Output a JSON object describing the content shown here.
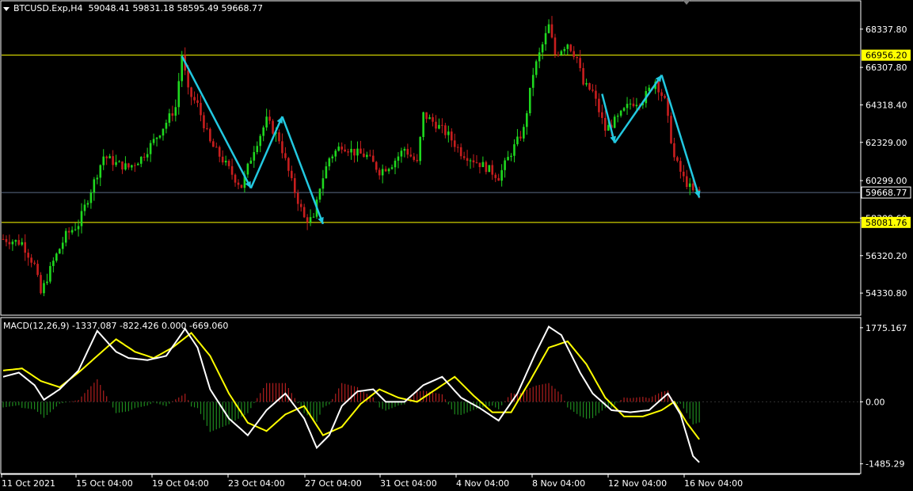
{
  "header": {
    "symbol": "BTCUSD.Exp,H4",
    "open": "59048.41",
    "high": "59831.18",
    "low": "58595.49",
    "close": "59668.77"
  },
  "macd": {
    "label": "MACD(12,26,9)",
    "values": "-1337.087 -822.426 0.000 -669.060",
    "top_label": "1775.167",
    "zero_label": "0.00",
    "bottom_label": "-1485.29",
    "top_value": 1775.167,
    "bottom_value": -1485.29
  },
  "price_axis": {
    "labels": [
      "68337.80",
      "66307.80",
      "64318.40",
      "62329.00",
      "60299.00",
      "58309.60",
      "56320.20",
      "54330.80"
    ],
    "max": 69800,
    "min": 53200
  },
  "levels": [
    {
      "value": 66956.2,
      "label": "66956.20",
      "color": "#ffff00",
      "label_bg": "#ffff00",
      "label_fg": "#000000"
    },
    {
      "value": 58081.76,
      "label": "58081.76",
      "color": "#ffff00",
      "label_bg": "#ffff00",
      "label_fg": "#000000"
    }
  ],
  "current_price": {
    "value": 59668.77,
    "label": "59668.77",
    "color": "#5a6a86"
  },
  "time_axis": [
    "11 Oct 2021",
    "15 Oct 04:00",
    "19 Oct 04:00",
    "23 Oct 04:00",
    "27 Oct 04:00",
    "31 Oct 04:00",
    "4 Nov 04:00",
    "8 Nov 04:00",
    "12 Nov 04:00",
    "16 Nov 04:00"
  ],
  "colors": {
    "bull": "#1fd81f",
    "bear": "#c81e1e",
    "arrow": "#22c8e0",
    "macd_line": "#ffffff",
    "signal_line": "#ffff00",
    "hist_pos": "#b01e1e",
    "hist_neg": "#1e8a1e",
    "grid": "#ffffff"
  },
  "chart_data": {
    "type": "candlestick",
    "timeframe": "H4",
    "price_path": [
      {
        "t": 0,
        "p": 57200
      },
      {
        "t": 6,
        "p": 57000
      },
      {
        "t": 10,
        "p": 55800
      },
      {
        "t": 12,
        "p": 54300
      },
      {
        "t": 16,
        "p": 56000
      },
      {
        "t": 20,
        "p": 57400
      },
      {
        "t": 24,
        "p": 58000
      },
      {
        "t": 28,
        "p": 59800
      },
      {
        "t": 32,
        "p": 61600
      },
      {
        "t": 36,
        "p": 61200
      },
      {
        "t": 40,
        "p": 61000
      },
      {
        "t": 44,
        "p": 61500
      },
      {
        "t": 48,
        "p": 62400
      },
      {
        "t": 52,
        "p": 63400
      },
      {
        "t": 55,
        "p": 64200
      },
      {
        "t": 57,
        "p": 67000
      },
      {
        "t": 59,
        "p": 65000
      },
      {
        "t": 62,
        "p": 64300
      },
      {
        "t": 66,
        "p": 62300
      },
      {
        "t": 70,
        "p": 61400
      },
      {
        "t": 74,
        "p": 60400
      },
      {
        "t": 76,
        "p": 60000
      },
      {
        "t": 80,
        "p": 62000
      },
      {
        "t": 84,
        "p": 63500
      },
      {
        "t": 88,
        "p": 62500
      },
      {
        "t": 92,
        "p": 60200
      },
      {
        "t": 96,
        "p": 58300
      },
      {
        "t": 99,
        "p": 58200
      },
      {
        "t": 101,
        "p": 60000
      },
      {
        "t": 104,
        "p": 61500
      },
      {
        "t": 108,
        "p": 62200
      },
      {
        "t": 112,
        "p": 61800
      },
      {
        "t": 116,
        "p": 61600
      },
      {
        "t": 120,
        "p": 60800
      },
      {
        "t": 124,
        "p": 61200
      },
      {
        "t": 128,
        "p": 62000
      },
      {
        "t": 132,
        "p": 61200
      },
      {
        "t": 134,
        "p": 63800
      },
      {
        "t": 138,
        "p": 63300
      },
      {
        "t": 142,
        "p": 62700
      },
      {
        "t": 146,
        "p": 61800
      },
      {
        "t": 150,
        "p": 61400
      },
      {
        "t": 154,
        "p": 61000
      },
      {
        "t": 158,
        "p": 60500
      },
      {
        "t": 162,
        "p": 61800
      },
      {
        "t": 166,
        "p": 63000
      },
      {
        "t": 169,
        "p": 66000
      },
      {
        "t": 172,
        "p": 67500
      },
      {
        "t": 174,
        "p": 68500
      },
      {
        "t": 176,
        "p": 67000
      },
      {
        "t": 180,
        "p": 67600
      },
      {
        "t": 183,
        "p": 66800
      },
      {
        "t": 185,
        "p": 65400
      },
      {
        "t": 188,
        "p": 65000
      },
      {
        "t": 192,
        "p": 63000
      },
      {
        "t": 196,
        "p": 63600
      },
      {
        "t": 200,
        "p": 64400
      },
      {
        "t": 204,
        "p": 64600
      },
      {
        "t": 208,
        "p": 65600
      },
      {
        "t": 211,
        "p": 64500
      },
      {
        "t": 214,
        "p": 61500
      },
      {
        "t": 217,
        "p": 60400
      },
      {
        "t": 220,
        "p": 59700
      },
      {
        "t": 222,
        "p": 59700
      }
    ],
    "arrows": [
      {
        "from": [
          57,
          66900
        ],
        "to": [
          79,
          59900
        ]
      },
      {
        "from": [
          79,
          59900
        ],
        "to": [
          89,
          63700
        ]
      },
      {
        "from": [
          89,
          63700
        ],
        "to": [
          102,
          58000
        ]
      },
      {
        "from": [
          191,
          64900
        ],
        "to": [
          195,
          62300
        ]
      },
      {
        "from": [
          195,
          62300
        ],
        "to": [
          210,
          65900
        ]
      },
      {
        "from": [
          210,
          65900
        ],
        "to": [
          222,
          59400
        ]
      }
    ],
    "macd_path": [
      {
        "t": 0,
        "v": 600
      },
      {
        "t": 5,
        "v": 700
      },
      {
        "t": 10,
        "v": 400
      },
      {
        "t": 13,
        "v": 50
      },
      {
        "t": 18,
        "v": 300
      },
      {
        "t": 24,
        "v": 750
      },
      {
        "t": 30,
        "v": 1700
      },
      {
        "t": 36,
        "v": 1200
      },
      {
        "t": 40,
        "v": 1050
      },
      {
        "t": 46,
        "v": 1000
      },
      {
        "t": 52,
        "v": 1100
      },
      {
        "t": 58,
        "v": 1750
      },
      {
        "t": 62,
        "v": 1300
      },
      {
        "t": 66,
        "v": 300
      },
      {
        "t": 72,
        "v": -400
      },
      {
        "t": 78,
        "v": -800
      },
      {
        "t": 84,
        "v": -200
      },
      {
        "t": 90,
        "v": 200
      },
      {
        "t": 96,
        "v": -400
      },
      {
        "t": 100,
        "v": -1100
      },
      {
        "t": 104,
        "v": -800
      },
      {
        "t": 108,
        "v": -100
      },
      {
        "t": 113,
        "v": 250
      },
      {
        "t": 118,
        "v": 300
      },
      {
        "t": 122,
        "v": 0
      },
      {
        "t": 128,
        "v": 0
      },
      {
        "t": 134,
        "v": 400
      },
      {
        "t": 140,
        "v": 600
      },
      {
        "t": 146,
        "v": 100
      },
      {
        "t": 152,
        "v": -150
      },
      {
        "t": 158,
        "v": -450
      },
      {
        "t": 164,
        "v": 200
      },
      {
        "t": 170,
        "v": 1200
      },
      {
        "t": 174,
        "v": 1800
      },
      {
        "t": 178,
        "v": 1600
      },
      {
        "t": 184,
        "v": 700
      },
      {
        "t": 188,
        "v": 200
      },
      {
        "t": 194,
        "v": -200
      },
      {
        "t": 200,
        "v": -250
      },
      {
        "t": 206,
        "v": -200
      },
      {
        "t": 212,
        "v": 200
      },
      {
        "t": 216,
        "v": -300
      },
      {
        "t": 220,
        "v": -1300
      },
      {
        "t": 222,
        "v": -1450
      }
    ],
    "signal_path": [
      {
        "t": 0,
        "v": 750
      },
      {
        "t": 6,
        "v": 800
      },
      {
        "t": 12,
        "v": 500
      },
      {
        "t": 18,
        "v": 350
      },
      {
        "t": 24,
        "v": 700
      },
      {
        "t": 30,
        "v": 1100
      },
      {
        "t": 36,
        "v": 1500
      },
      {
        "t": 42,
        "v": 1200
      },
      {
        "t": 48,
        "v": 1050
      },
      {
        "t": 54,
        "v": 1300
      },
      {
        "t": 60,
        "v": 1650
      },
      {
        "t": 66,
        "v": 1100
      },
      {
        "t": 72,
        "v": 200
      },
      {
        "t": 78,
        "v": -500
      },
      {
        "t": 84,
        "v": -700
      },
      {
        "t": 90,
        "v": -300
      },
      {
        "t": 96,
        "v": -100
      },
      {
        "t": 102,
        "v": -800
      },
      {
        "t": 108,
        "v": -600
      },
      {
        "t": 114,
        "v": -50
      },
      {
        "t": 120,
        "v": 300
      },
      {
        "t": 126,
        "v": 100
      },
      {
        "t": 132,
        "v": 0
      },
      {
        "t": 138,
        "v": 300
      },
      {
        "t": 144,
        "v": 600
      },
      {
        "t": 150,
        "v": 150
      },
      {
        "t": 156,
        "v": -250
      },
      {
        "t": 162,
        "v": -250
      },
      {
        "t": 168,
        "v": 500
      },
      {
        "t": 174,
        "v": 1300
      },
      {
        "t": 180,
        "v": 1450
      },
      {
        "t": 186,
        "v": 900
      },
      {
        "t": 192,
        "v": 100
      },
      {
        "t": 198,
        "v": -350
      },
      {
        "t": 204,
        "v": -350
      },
      {
        "t": 210,
        "v": -200
      },
      {
        "t": 214,
        "v": 0
      },
      {
        "t": 218,
        "v": -500
      },
      {
        "t": 222,
        "v": -900
      }
    ]
  }
}
